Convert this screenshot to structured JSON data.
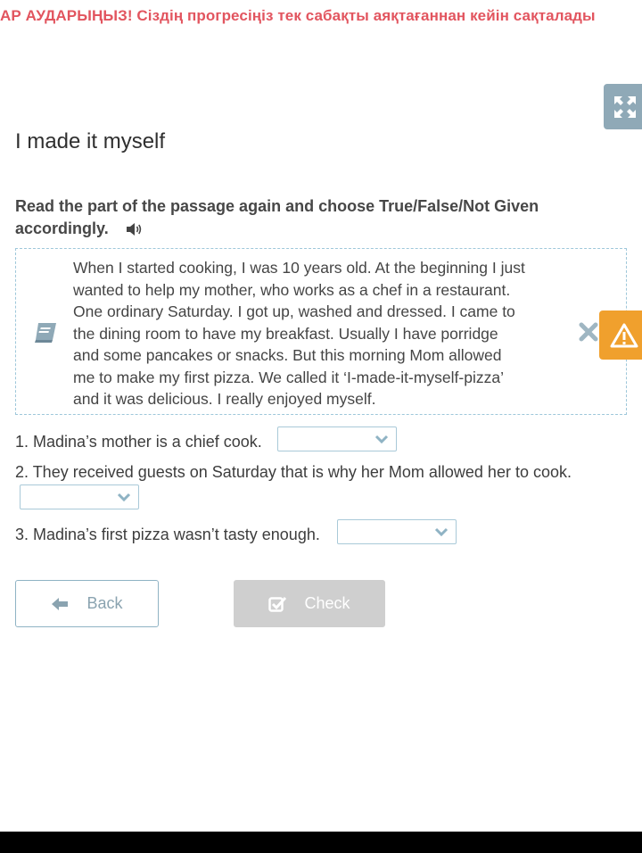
{
  "banner": {
    "text": "АР АУДАРЫҢЫЗ! Сіздің прогресіңіз тек сабақты аяқтағаннан кейін сақталады"
  },
  "lesson": {
    "title": "I made it myself"
  },
  "task": {
    "instruction": "Read the part of the passage again and choose True/False/Not Given accordingly."
  },
  "passage": {
    "lines": [
      "When I started cooking, I was 10 years old. At the beginning I just",
      "wanted to help my mother, who works as a chef in a restaurant.",
      "One ordinary Saturday. I got up, washed and dressed. I came to",
      "the dining room to have my breakfast. Usually I have porridge",
      "and some pancakes or snacks. But this morning Mom allowed",
      "me to make my first pizza. We called it ‘I-made-it-myself-pizza’",
      "and it was delicious. I really enjoyed myself."
    ]
  },
  "questions": [
    {
      "text": "1. Madina’s mother is a chief cook.",
      "selected": ""
    },
    {
      "text": "2. They received guests on Saturday that is why her Mom allowed her to cook.",
      "selected": ""
    },
    {
      "text": "3. Madina’s first pizza wasn’t tasty enough.",
      "selected": ""
    }
  ],
  "buttons": {
    "back": "Back",
    "check": "Check"
  },
  "icons": {
    "fullscreen": "expand-arrows-icon",
    "speaker": "speaker-icon",
    "book": "book-icon",
    "close": "close-icon",
    "report": "warning-triangle-icon",
    "dropdown": "chevron-down-icon",
    "back": "arrow-left-icon",
    "check": "checkbox-check-icon"
  },
  "colors": {
    "banner": "#e2555f",
    "accent_border": "#9ec7da",
    "fullscreen_bg": "#8fa9b7",
    "report_bg": "#f0a02d",
    "check_disabled": "#cfcfcf"
  }
}
